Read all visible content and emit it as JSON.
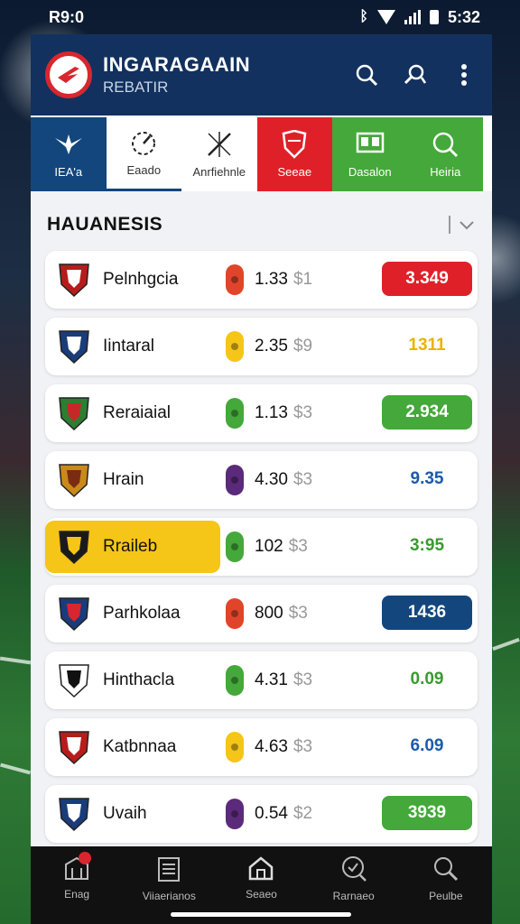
{
  "status": {
    "time": "R9:0",
    "clock": "5:32"
  },
  "app": {
    "title": "INGARAGAAIN",
    "subtitle": "REBATIR"
  },
  "tabs": [
    {
      "label": "IEA'a",
      "icon": "bird-icon",
      "style": "blue"
    },
    {
      "label": "Eaado",
      "icon": "stopwatch-icon",
      "style": "white"
    },
    {
      "label": "Anrfiehnle",
      "icon": "cross-arrows-icon",
      "style": "white2"
    },
    {
      "label": "Seeae",
      "icon": "shield-icon",
      "style": "red"
    },
    {
      "label": "Dasalon",
      "icon": "scoreboard-icon",
      "style": "green"
    },
    {
      "label": "Heiria",
      "icon": "search-icon",
      "style": "green"
    }
  ],
  "section": {
    "title": "HAUANESIS"
  },
  "colors": {
    "red": "#e02028",
    "green": "#44a83a",
    "blue": "#13467c",
    "yellow": "#f5c518"
  },
  "rows": [
    {
      "team": "Pelnhgcia",
      "odds": "1.33",
      "cur": "$1",
      "value": "3.349",
      "value_style": "red",
      "pill": "red",
      "crest": "red"
    },
    {
      "team": "Iintaral",
      "odds": "2.35",
      "cur": "$9",
      "value": "1311",
      "value_style": "text-yellow",
      "pill": "yellow",
      "crest": "blue"
    },
    {
      "team": "Reraiaial",
      "odds": "1.13",
      "cur": "$3",
      "value": "2.934",
      "value_style": "green",
      "pill": "green",
      "crest": "green"
    },
    {
      "team": "Hrain",
      "odds": "4.30",
      "cur": "$3",
      "value": "9.35",
      "value_style": "text-blue",
      "pill": "purple",
      "crest": "orange"
    },
    {
      "team": "Rraileb",
      "odds": "102",
      "cur": "$3",
      "value": "3:95",
      "value_style": "text-green",
      "pill": "green-arrow",
      "crest": "black",
      "highlight": true
    },
    {
      "team": "Parhkolaa",
      "odds": "800",
      "cur": "$3",
      "value": "1436",
      "value_style": "blue",
      "pill": "red",
      "crest": "red-blue"
    },
    {
      "team": "Hinthacla",
      "odds": "4.31",
      "cur": "$3",
      "value": "0.09",
      "value_style": "text-green",
      "pill": "green",
      "crest": "white"
    },
    {
      "team": "Katbnnaa",
      "odds": "4.63",
      "cur": "$3",
      "value": "6.09",
      "value_style": "text-blue",
      "pill": "yellow",
      "crest": "red"
    },
    {
      "team": "Uvaih",
      "odds": "0.54",
      "cur": "$2",
      "value": "3939",
      "value_style": "green",
      "pill": "purple",
      "crest": "blue"
    }
  ],
  "nav": [
    {
      "label": "Enag",
      "icon": "building-icon",
      "badge": true
    },
    {
      "label": "Viiaerianos",
      "icon": "clipboard-icon"
    },
    {
      "label": "Seaeo",
      "icon": "home-icon"
    },
    {
      "label": "Rarnaeo",
      "icon": "search-icon"
    },
    {
      "label": "Peulbe",
      "icon": "magnifier-icon"
    }
  ]
}
